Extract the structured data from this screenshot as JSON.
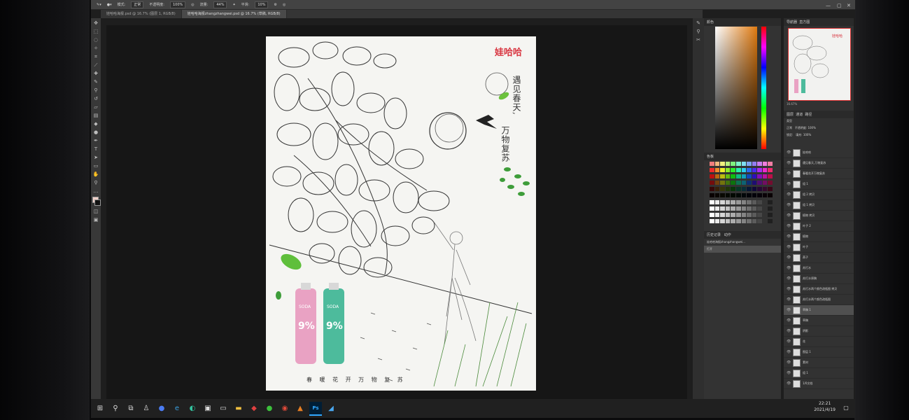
{
  "options_bar": {
    "mode_label": "模式:",
    "mode_value": "正常",
    "opacity_label": "不透明度:",
    "opacity_value": "100%",
    "flow_label": "流量:",
    "flow_value": "44%",
    "smooth_label": "平滑:",
    "smooth_value": "10%"
  },
  "tabs": [
    {
      "label": "娃哈哈海报.psd @ 16.7% (图层 1, RGB/8)"
    },
    {
      "label": "娃哈哈海报zhangzhangwei.psd @ 16.7% (草稿, RGB/8)"
    }
  ],
  "poster": {
    "brand": "娃哈哈",
    "title_line1": "遇见春天,",
    "title_line2": "万物复苏",
    "bottom_line": "春 暖 花 开 万 物 复 苏"
  },
  "statusbar": {
    "zoom": "16.67%",
    "doc_info": "文档:111.2M/1.06G"
  },
  "panels": {
    "color_tab": "颜色",
    "swatches_tab": "色板",
    "navigator_tab": "导航器",
    "histogram_tab": "直方图",
    "layers_tab": "图层",
    "channels_tab": "通道",
    "paths_tab": "路径",
    "history_tab": "历史记录",
    "actions_tab": "动作",
    "kind_label": "类型",
    "blend_value": "正常",
    "layer_opacity_label": "不透明度:",
    "layer_opacity_value": "100%",
    "fill_label": "填充:",
    "fill_value": "100%",
    "lock_label": "锁定:",
    "nav_zoom": "16.67%",
    "history_items": [
      {
        "label": "娃哈哈海报zhangzhangwei..."
      },
      {
        "label": "打开"
      }
    ]
  },
  "layers": [
    {
      "name": "娃哈哈"
    },
    {
      "name": "遇见春天,万物复苏"
    },
    {
      "name": "春暖花开万物复苏"
    },
    {
      "name": "组 1"
    },
    {
      "name": "组 2 拷贝"
    },
    {
      "name": "组 1 拷贝"
    },
    {
      "name": "植物 拷贝"
    },
    {
      "name": "叶子 2"
    },
    {
      "name": "植物"
    },
    {
      "name": "叶子"
    },
    {
      "name": "燕子"
    },
    {
      "name": "苏打水"
    },
    {
      "name": "苏打水原稿"
    },
    {
      "name": "苏打水两个颜色改瓶图 拷贝"
    },
    {
      "name": "苏打水两个颜色改瓶图"
    },
    {
      "name": "草稿 1"
    },
    {
      "name": "草稿"
    },
    {
      "name": "阴影"
    },
    {
      "name": "花"
    },
    {
      "name": "图层 1"
    },
    {
      "name": "素材"
    },
    {
      "name": "组 1"
    },
    {
      "name": "1/0文档"
    }
  ],
  "taskbar": {
    "time": "22:21",
    "date": "2021/4/19",
    "ps_label": "Ps"
  }
}
